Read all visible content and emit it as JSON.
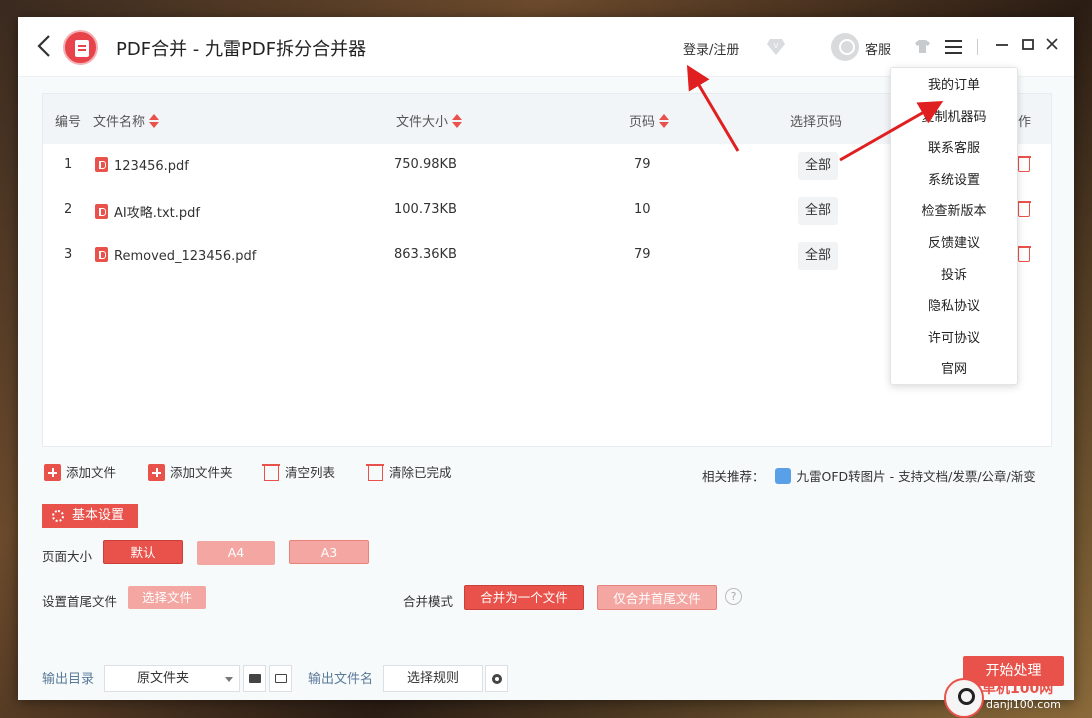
{
  "titlebar": {
    "title": "PDF合并 - 九雷PDF拆分合并器",
    "login": "登录/注册",
    "service": "客服"
  },
  "table": {
    "headers": {
      "index": "编号",
      "name": "文件名称",
      "size": "文件大小",
      "pages": "页码",
      "select_pages": "选择页码",
      "action_partial": "作"
    },
    "rows": [
      {
        "index": "1",
        "name": "123456.pdf",
        "size": "750.98KB",
        "pages": "79",
        "select": "全部"
      },
      {
        "index": "2",
        "name": "AI攻略.txt.pdf",
        "size": "100.73KB",
        "pages": "10",
        "select": "全部"
      },
      {
        "index": "3",
        "name": "Removed_123456.pdf",
        "size": "863.36KB",
        "pages": "79",
        "select": "全部"
      }
    ]
  },
  "actions": {
    "add_file": "添加文件",
    "add_folder": "添加文件夹",
    "clear_list": "清空列表",
    "clear_done": "清除已完成",
    "recommend_label": "相关推荐：",
    "recommend_text": "九雷OFD转图片 - 支持文档/发票/公章/渐变"
  },
  "settings": {
    "title": "基本设置",
    "page_size_label": "页面大小",
    "page_sizes": [
      "默认",
      "A4",
      "A3"
    ],
    "head_tail_label": "设置首尾文件",
    "choose_file": "选择文件",
    "merge_mode_label": "合并模式",
    "merge_modes": [
      "合并为一个文件",
      "仅合并首尾文件"
    ],
    "help": "?"
  },
  "output": {
    "dir_label": "输出目录",
    "dir_value": "原文件夹",
    "filename_label": "输出文件名",
    "rule_button": "选择规则",
    "start_button": "开始处理"
  },
  "menu": {
    "items": [
      "我的订单",
      "复制机器码",
      "联系客服",
      "系统设置",
      "检查新版本",
      "反馈建议",
      "投诉",
      "隐私协议",
      "许可协议",
      "官网"
    ]
  },
  "watermark": {
    "text": "单机100网",
    "url": "danji100.com"
  },
  "colors": {
    "accent": "#e8524a",
    "accent_light": "#f4a7a2",
    "arrow": "#e02020"
  }
}
